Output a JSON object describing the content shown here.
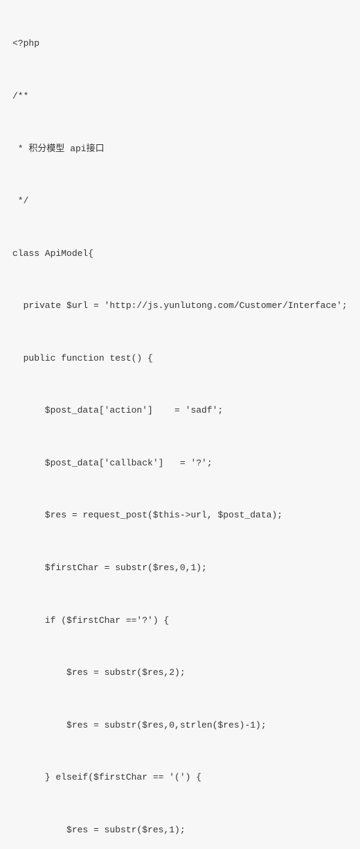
{
  "code": {
    "lines": [
      "<?php",
      "/**",
      " * 积分模型 api接口",
      " */",
      "class ApiModel{",
      "  private $url = 'http://js.yunlutong.com/Customer/Interface';",
      "  public function test() {",
      "      $post_data['action']    = 'sadf';",
      "      $post_data['callback']   = '?';",
      "      $res = request_post($this->url, $post_data);",
      "      $firstChar = substr($res,0,1);",
      "      if ($firstChar =='?') {",
      "          $res = substr($res,2);",
      "          $res = substr($res,0,strlen($res)-1);",
      "      } elseif($firstChar == '(') {",
      "          $res = substr($res,1);"
    ]
  }
}
